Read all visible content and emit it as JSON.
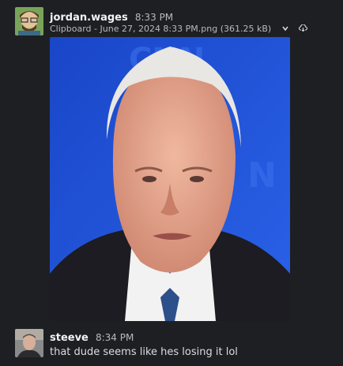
{
  "messages": [
    {
      "username": "jordan.wages",
      "time": "8:33 PM",
      "attachment": {
        "filename": "Clipboard - June 27, 2024 8:33 PM.png",
        "size": "(361.25 kB)",
        "expand_icon": "chevron-down-icon",
        "action_icon": "cloud-download-icon"
      }
    },
    {
      "username": "steeve",
      "time": "8:34 PM",
      "text": "that dude seems like hes losing it lol"
    }
  ],
  "colors": {
    "background": "#1e1f22",
    "username": "#f2f3f5",
    "meta": "#b5bac1",
    "image_backdrop": "#1f4fd0"
  }
}
